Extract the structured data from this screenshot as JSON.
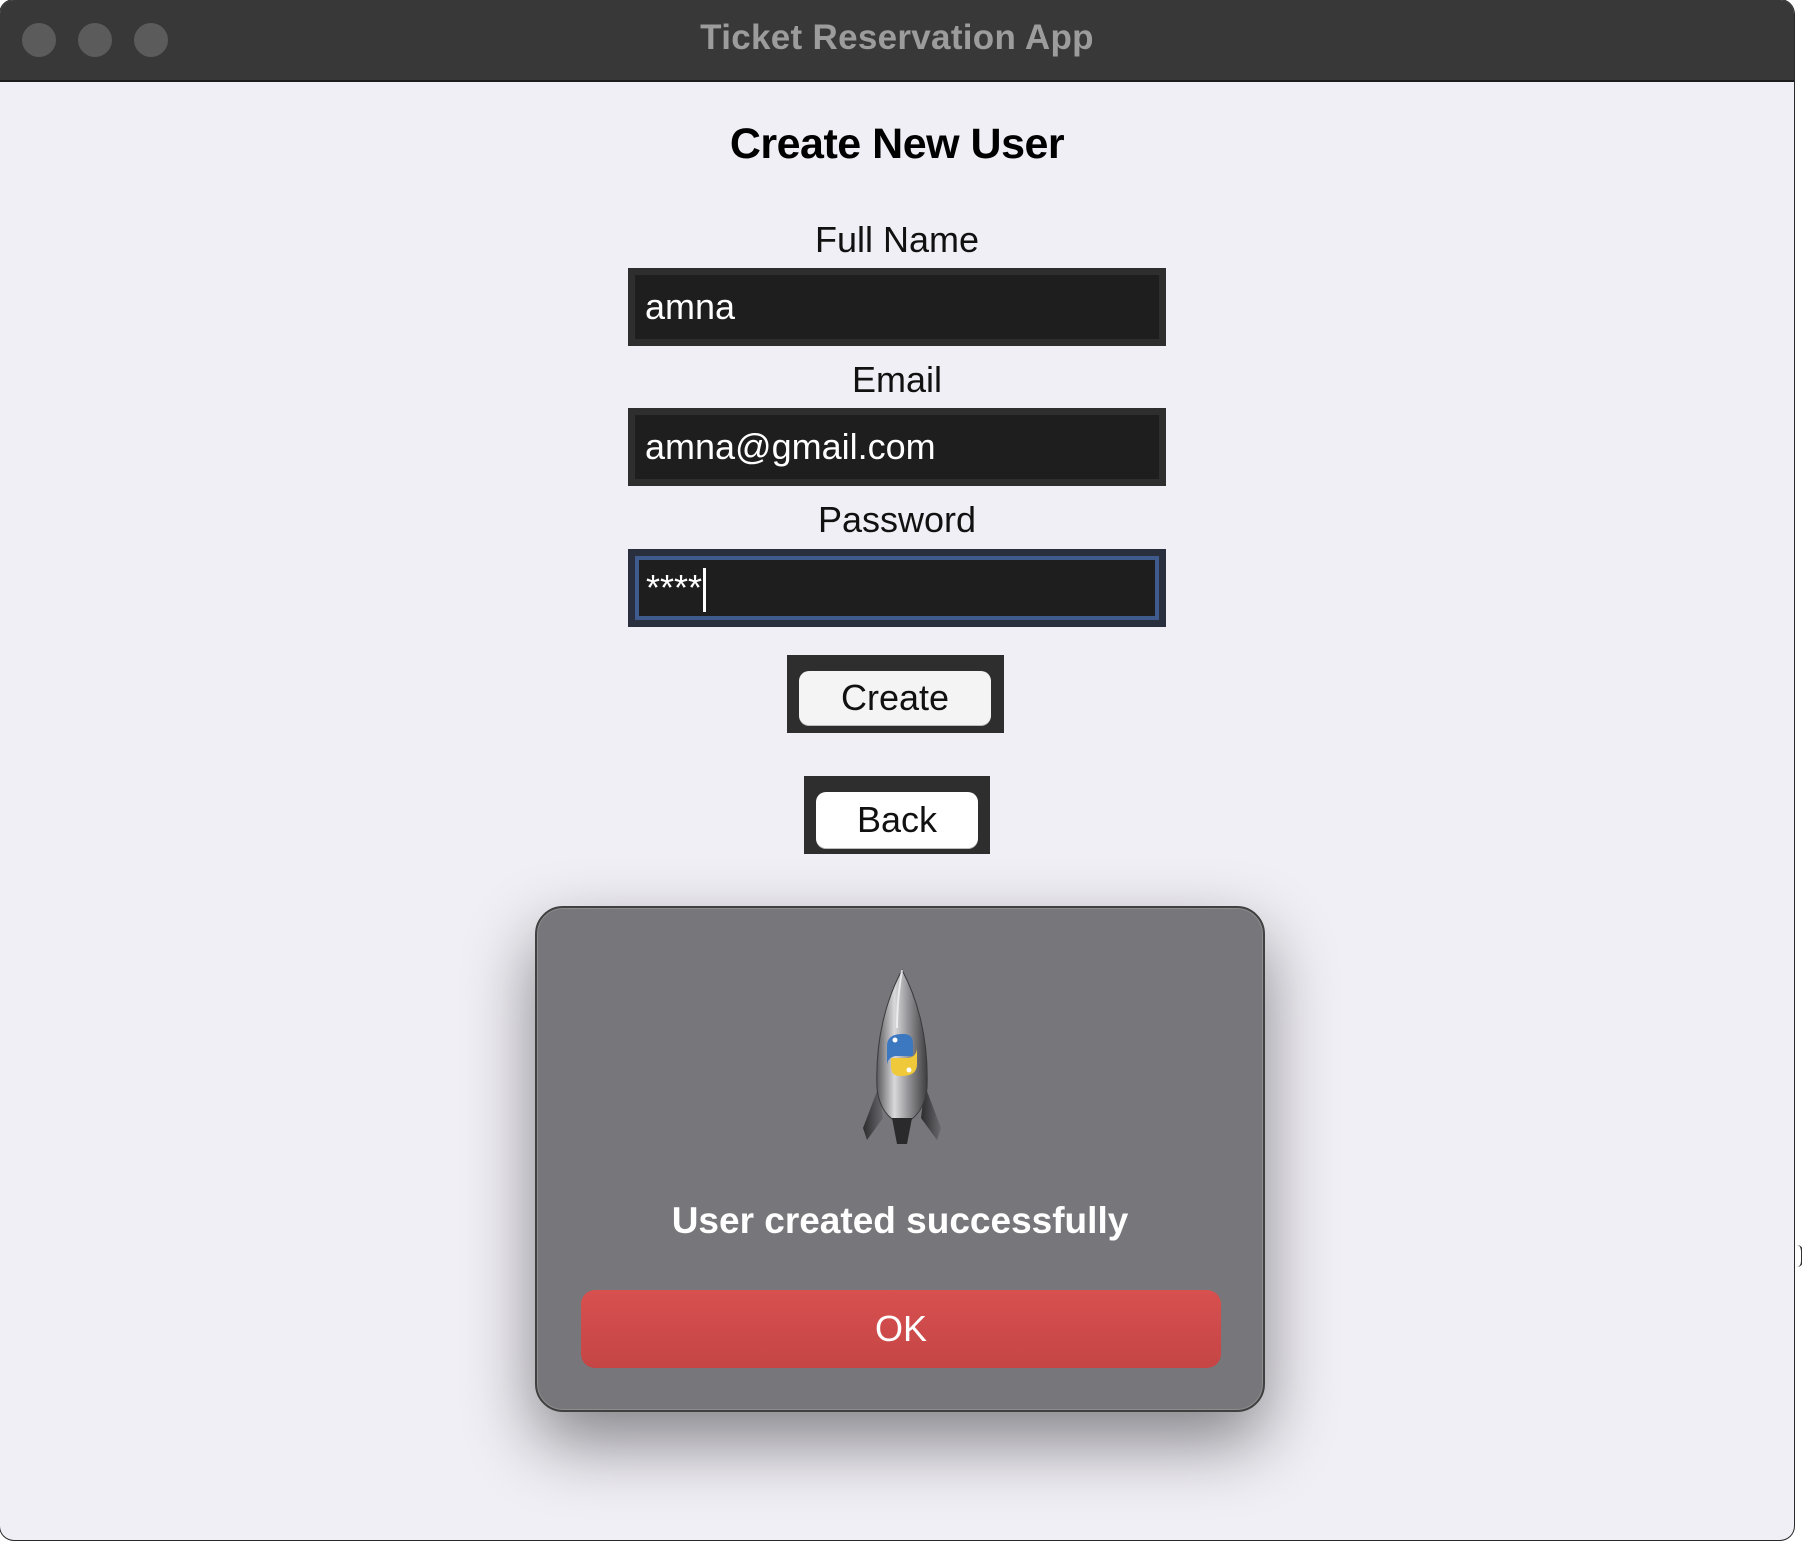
{
  "window": {
    "title": "Ticket Reservation App"
  },
  "form": {
    "heading": "Create New User",
    "full_name_label": "Full Name",
    "full_name_value": "amna",
    "email_label": "Email",
    "email_value": "amna@gmail.com",
    "password_label": "Password",
    "password_value": "****",
    "create_label": "Create",
    "back_label": "Back"
  },
  "dialog": {
    "icon": "python-launcher-rocket-icon",
    "message": "User created successfully",
    "ok_label": "OK"
  },
  "colors": {
    "ok_button": "#d24c4c",
    "focus_ring": "#3f5a8c",
    "field_bg": "#1e1e1e",
    "window_bg": "#f0eff5"
  }
}
